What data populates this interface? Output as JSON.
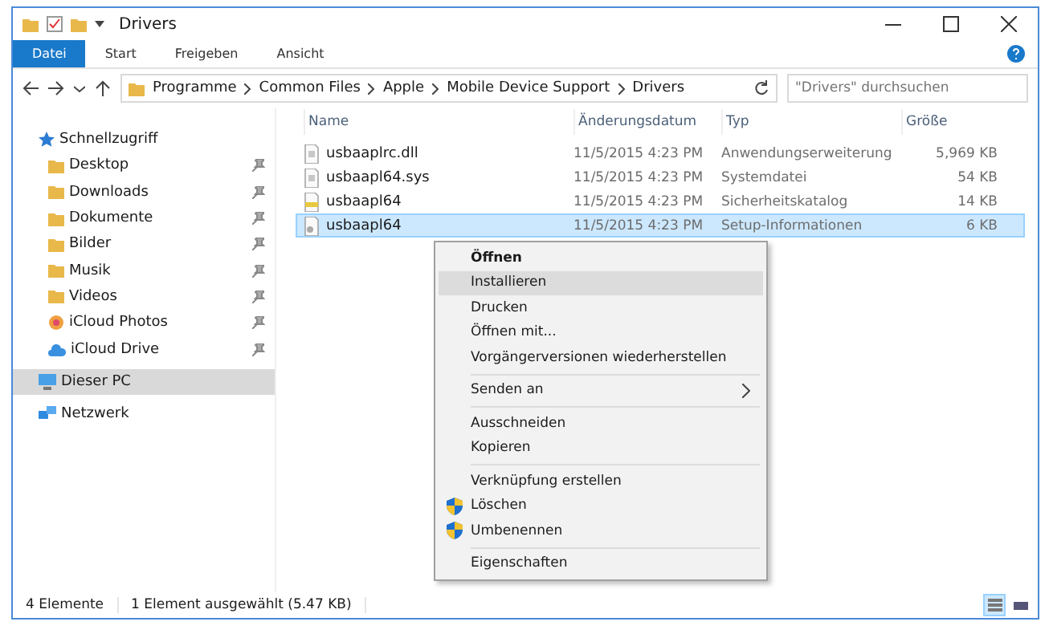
{
  "window": {
    "title": "Drivers"
  },
  "ribbon_tabs": [
    {
      "label": "Datei",
      "selected": true
    },
    {
      "label": "Start",
      "selected": false
    },
    {
      "label": "Freigeben",
      "selected": false
    },
    {
      "label": "Ansicht",
      "selected": false
    }
  ],
  "address": {
    "path": [
      "Programme",
      "Common Files",
      "Apple",
      "Mobile Device Support",
      "Drivers"
    ]
  },
  "search": {
    "placeholder": "\"Drivers\" durchsuchen"
  },
  "sidebar": {
    "items": [
      {
        "label": "Schnellzugriff",
        "kind": "star",
        "selected": false,
        "children": [
          {
            "label": "Desktop",
            "kind": "folder",
            "pinned": true,
            "selected": false
          },
          {
            "label": "Downloads",
            "kind": "folder",
            "pinned": true,
            "selected": false
          },
          {
            "label": "Dokumente",
            "kind": "folder",
            "pinned": true,
            "selected": false
          },
          {
            "label": "Bilder",
            "kind": "folder",
            "pinned": true,
            "selected": false
          },
          {
            "label": "Musik",
            "kind": "folder",
            "pinned": true,
            "selected": false
          },
          {
            "label": "Videos",
            "kind": "folder",
            "pinned": true,
            "selected": false
          },
          {
            "label": "iCloud Photos",
            "kind": "photos",
            "pinned": true,
            "selected": false
          },
          {
            "label": "iCloud Drive",
            "kind": "cloud",
            "pinned": true,
            "selected": false
          }
        ]
      },
      {
        "label": "Dieser PC",
        "kind": "pc",
        "selected": true
      },
      {
        "label": "Netzwerk",
        "kind": "network",
        "selected": false
      }
    ]
  },
  "table": {
    "columns": [
      "Name",
      "Änderungsdatum",
      "Typ",
      "Größe"
    ],
    "rows": [
      {
        "name": "usbaaplrc.dll",
        "date": "11/5/2015 4:23 PM",
        "type": "Anwendungserweiterung",
        "size": "5,969 KB",
        "kind": "file",
        "selected": false
      },
      {
        "name": "usbaapl64.sys",
        "date": "11/5/2015 4:23 PM",
        "type": "Systemdatei",
        "size": "54 KB",
        "kind": "file",
        "selected": false
      },
      {
        "name": "usbaapl64",
        "date": "11/5/2015 4:23 PM",
        "type": "Sicherheitskatalog",
        "size": "14 KB",
        "kind": "catalog",
        "selected": false
      },
      {
        "name": "usbaapl64",
        "date": "11/5/2015 4:23 PM",
        "type": "Setup-Informationen",
        "size": "6 KB",
        "kind": "setup",
        "selected": true
      }
    ]
  },
  "context_menu": {
    "groups": [
      [
        {
          "label": "Öffnen",
          "kind": "default",
          "selected": false
        },
        {
          "label": "Installieren",
          "kind": "plain",
          "selected": true
        },
        {
          "label": "Drucken",
          "kind": "plain",
          "selected": false
        },
        {
          "label": "Öffnen mit...",
          "kind": "plain",
          "selected": false
        },
        {
          "label": "Vorgängerversionen wiederherstellen",
          "kind": "plain",
          "selected": false
        }
      ],
      [
        {
          "label": "Senden an",
          "kind": "submenu",
          "selected": false
        }
      ],
      [
        {
          "label": "Ausschneiden",
          "kind": "plain",
          "selected": false
        },
        {
          "label": "Kopieren",
          "kind": "plain",
          "selected": false
        }
      ],
      [
        {
          "label": "Verknüpfung erstellen",
          "kind": "plain",
          "selected": false
        },
        {
          "label": "Löschen",
          "kind": "shield",
          "selected": false
        },
        {
          "label": "Umbenennen",
          "kind": "shield",
          "selected": false
        }
      ],
      [
        {
          "label": "Eigenschaften",
          "kind": "plain",
          "selected": false
        }
      ]
    ]
  },
  "status_bar": {
    "count": "4 Elemente",
    "selection": "1 Element ausgewählt (5.47 KB)"
  },
  "view_buttons": [
    {
      "kind": "details",
      "selected": true
    },
    {
      "kind": "tiles",
      "selected": false
    }
  ]
}
